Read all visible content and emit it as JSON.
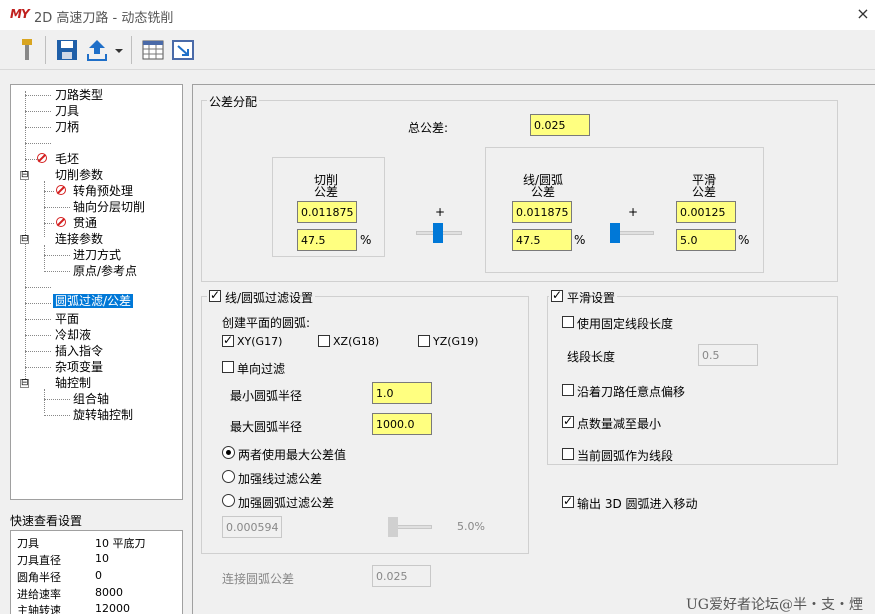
{
  "window": {
    "logo": "MY",
    "title": "2D 高速刀路 - 动态铣削",
    "close": "×"
  },
  "toolbar": {
    "icons": [
      "tool-icon",
      "save-icon",
      "export-icon",
      "dropdown-icon",
      "table-icon",
      "resize-icon"
    ]
  },
  "tree": {
    "items": [
      "刀路类型",
      "刀具",
      "刀柄",
      "毛坯",
      "切削参数",
      "转角预处理",
      "轴向分层切削",
      "贯通",
      "连接参数",
      "进刀方式",
      "原点/参考点",
      "圆弧过滤/公差",
      "平面",
      "冷却液",
      "插入指令",
      "杂项变量",
      "轴控制",
      "组合轴",
      "旋转轴控制"
    ],
    "expanders": [
      "⊟",
      "⊟",
      "⊟"
    ]
  },
  "quickview": {
    "label": "快速查看设置",
    "rows": [
      {
        "k": "刀具",
        "v": "10 平底刀"
      },
      {
        "k": "刀具直径",
        "v": "10"
      },
      {
        "k": "圆角半径",
        "v": "0"
      },
      {
        "k": "进给速率",
        "v": "8000"
      },
      {
        "k": "主轴转速",
        "v": "12000"
      }
    ]
  },
  "tolerance": {
    "group_title": "公差分配",
    "total_label": "总公差:",
    "total_value": "0.025",
    "cut_label": "切削\n公差",
    "cut_value": "0.011875",
    "cut_percent": "47.5",
    "line_arc_label": "线/圆弧\n公差",
    "line_arc_value": "0.011875",
    "line_arc_percent": "47.5",
    "smooth_label": "平滑\n公差",
    "smooth_value": "0.00125",
    "smooth_percent": "5.0",
    "plus": "+",
    "pct": "%",
    "slider1_fraction": 0.475,
    "slider2_fraction": 0.1
  },
  "arc_filter": {
    "title": "线/圆弧过滤设置",
    "checked": true,
    "create_plane_label": "创建平面的圆弧:",
    "xy": "XY(G17)",
    "xz": "XZ(G18)",
    "yz": "YZ(G19)",
    "one_way": "单向过滤",
    "min_radius_label": "最小圆弧半径",
    "min_radius": "1.0",
    "max_radius_label": "最大圆弧半径",
    "max_radius": "1000.0",
    "radio_both": "两者使用最大公差值",
    "radio_line": "加强线过滤公差",
    "radio_arc": "加强圆弧过滤公差",
    "disabled_value": "0.000594",
    "disabled_percent": "5.0%",
    "connect_label": "连接圆弧公差",
    "connect_value": "0.025"
  },
  "smooth": {
    "title": "平滑设置",
    "checked": true,
    "fixed_seg": "使用固定线段长度",
    "seg_len_label": "线段长度",
    "seg_len": "0.5",
    "offset_any": "沿着刀路任意点偏移",
    "reduce_pts": "点数量减至最小",
    "arc_as_seg": "当前圆弧作为线段"
  },
  "output_3d": "输出 3D 圆弧进入移动",
  "watermark": "UG爱好者论坛@半・支・煙"
}
